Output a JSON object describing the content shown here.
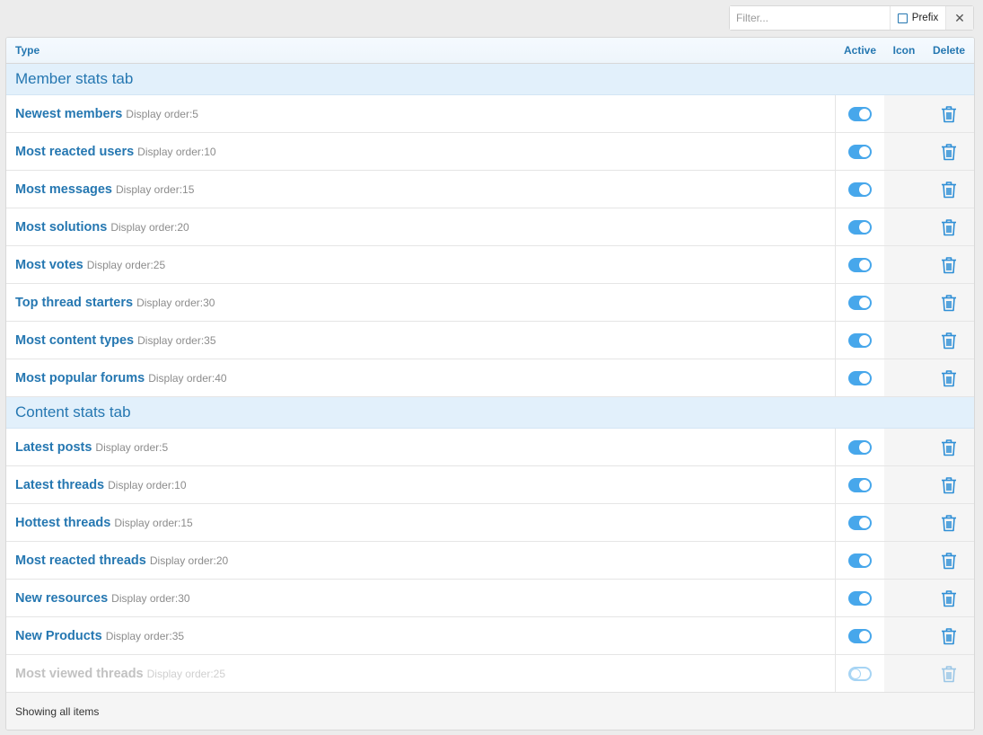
{
  "filter": {
    "placeholder": "Filter...",
    "prefix_label": "Prefix",
    "prefix_checked": false,
    "clear_glyph": "✕"
  },
  "table": {
    "headers": {
      "type": "Type",
      "active": "Active",
      "icon": "Icon",
      "delete": "Delete"
    },
    "groups": [
      {
        "title": "Member stats tab",
        "rows": [
          {
            "title": "Newest members",
            "order": "Display order:5",
            "active": true
          },
          {
            "title": "Most reacted users",
            "order": "Display order:10",
            "active": true
          },
          {
            "title": "Most messages",
            "order": "Display order:15",
            "active": true
          },
          {
            "title": "Most solutions",
            "order": "Display order:20",
            "active": true
          },
          {
            "title": "Most votes",
            "order": "Display order:25",
            "active": true
          },
          {
            "title": "Top thread starters",
            "order": "Display order:30",
            "active": true
          },
          {
            "title": "Most content types",
            "order": "Display order:35",
            "active": true
          },
          {
            "title": "Most popular forums",
            "order": "Display order:40",
            "active": true
          }
        ]
      },
      {
        "title": "Content stats tab",
        "rows": [
          {
            "title": "Latest posts",
            "order": "Display order:5",
            "active": true
          },
          {
            "title": "Latest threads",
            "order": "Display order:10",
            "active": true
          },
          {
            "title": "Hottest threads",
            "order": "Display order:15",
            "active": true
          },
          {
            "title": "Most reacted threads",
            "order": "Display order:20",
            "active": true
          },
          {
            "title": "New resources",
            "order": "Display order:30",
            "active": true
          },
          {
            "title": "New Products",
            "order": "Display order:35",
            "active": true
          },
          {
            "title": "Most viewed threads",
            "order": "Display order:25",
            "active": false
          }
        ]
      }
    ]
  },
  "footer": {
    "text": "Showing all items"
  },
  "icons": {
    "delete": "trash-icon"
  },
  "colors": {
    "accent": "#2577b1",
    "toggle_on": "#47a7eb",
    "group_bg": "#e2f0fb"
  }
}
